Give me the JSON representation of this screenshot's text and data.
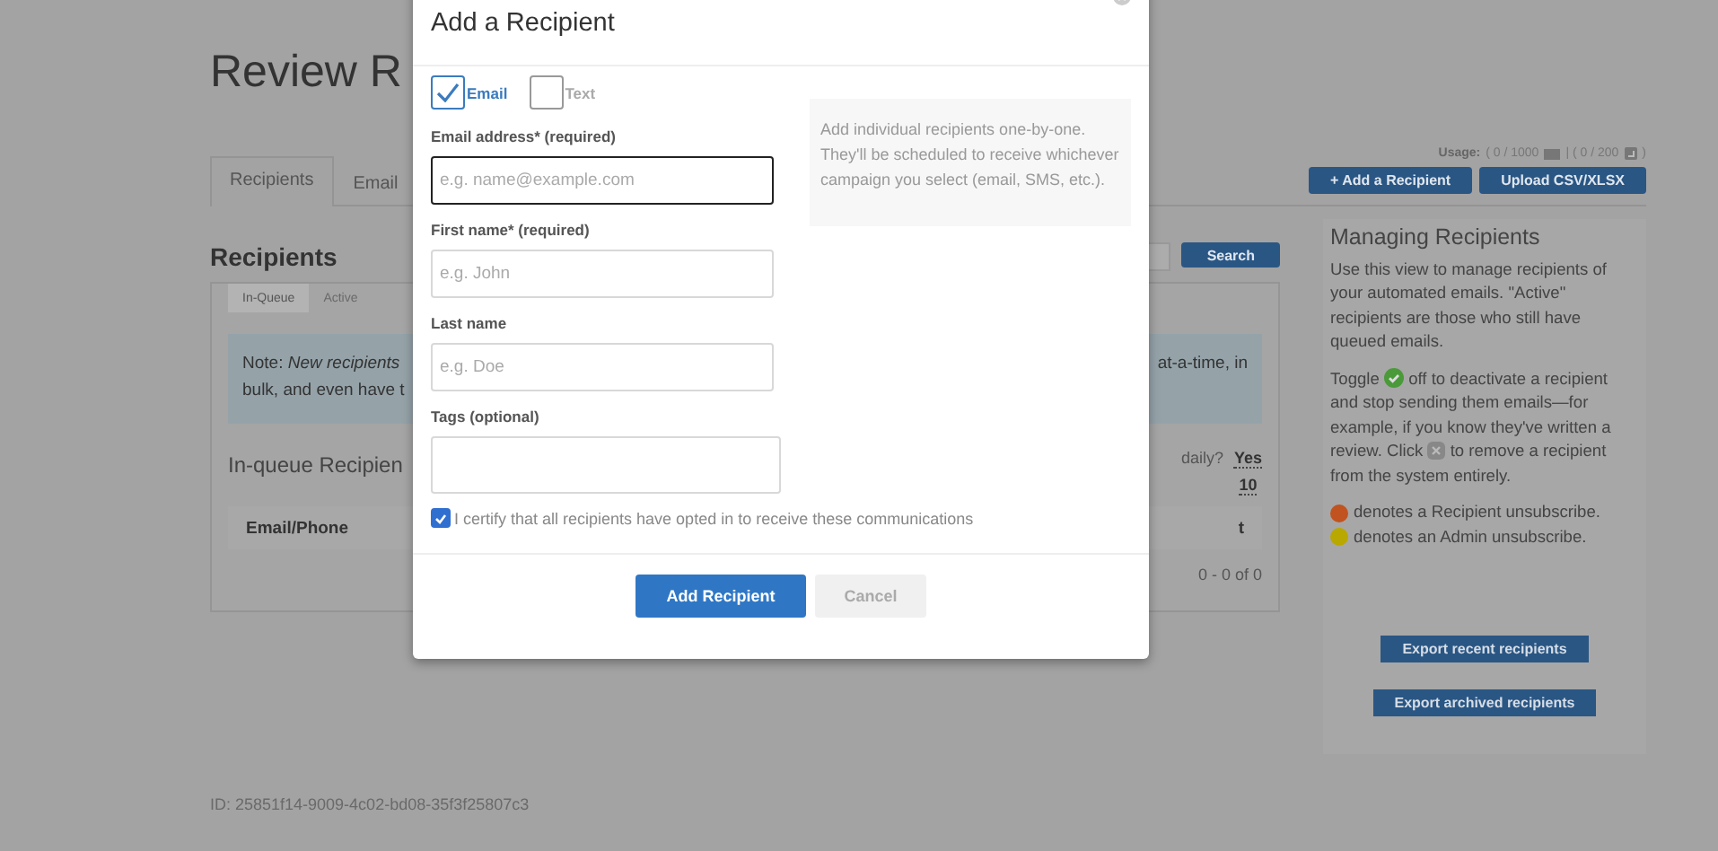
{
  "page": {
    "title": "Review R",
    "tabs": [
      {
        "label": "Recipients",
        "selected": true
      },
      {
        "label": "Email",
        "selected": false
      }
    ],
    "usage": {
      "label": "Usage:",
      "email_count": "( 0 / 1000",
      "separator": "| ( 0 / 200",
      "end": ")"
    },
    "actions": [
      "+ Add a Recipient",
      "Upload CSV/XLSX"
    ],
    "section_title": "Recipients",
    "subtabs": [
      {
        "label": "In-Queue",
        "selected": true
      },
      {
        "label": "Active",
        "selected": false
      }
    ],
    "search_button": "Search",
    "note": {
      "lines": [
        "Note: *New recipients*",
        "bulk, and even have t"
      ],
      "right": "at-a-time, in"
    },
    "queue": {
      "title": "In-queue Recipien",
      "daily_label": "daily?",
      "daily_value": "Yes",
      "count": "10"
    },
    "table": {
      "columns": [
        "Email/Phone",
        "t"
      ],
      "pagination": "0 - 0 of 0"
    },
    "footer_id": "ID: 25851f14-9009-4c02-bd08-35f3f25807c3"
  },
  "sidebar": {
    "title": "Managing Recipients",
    "intro": "Use this view to manage recipients of your automated emails. \"Active\" recipients are those who still have queued emails.",
    "toggle_parts": [
      "Toggle",
      "off to deactivate a recipient and stop sending them emails—for example, if you know they've written a review. Click",
      "to remove a recipient from the system entirely."
    ],
    "legend": [
      {
        "text": "denotes a Recipient unsubscribe.",
        "color": "#c0531f"
      },
      {
        "text": "denotes an Admin unsubscribe.",
        "color": "#b9a800"
      }
    ],
    "buttons": [
      "Export recent recipients",
      "Export archived recipients"
    ]
  },
  "modal": {
    "title": "Add a Recipient",
    "channels": [
      {
        "label": "Email",
        "checked": true
      },
      {
        "label": "Text",
        "checked": false
      }
    ],
    "fields": [
      {
        "label": "Email address* (required)",
        "placeholder": "e.g. name@example.com",
        "focused": true
      },
      {
        "label": "First name* (required)",
        "placeholder": "e.g. John",
        "focused": false
      },
      {
        "label": "Last name",
        "placeholder": "e.g. Doe",
        "focused": false
      },
      {
        "label": "Tags (optional)",
        "focused": false
      }
    ],
    "info": "Add individual recipients one-by-one. They'll be scheduled to receive whichever campaign you select (email, SMS, etc.).",
    "certify": {
      "label": "I certify that all recipients have opted in to receive these communications",
      "checked": true
    },
    "buttons": [
      {
        "label": "Add Recipient",
        "kind": "primary"
      },
      {
        "label": "Cancel",
        "kind": "secondary"
      }
    ]
  }
}
